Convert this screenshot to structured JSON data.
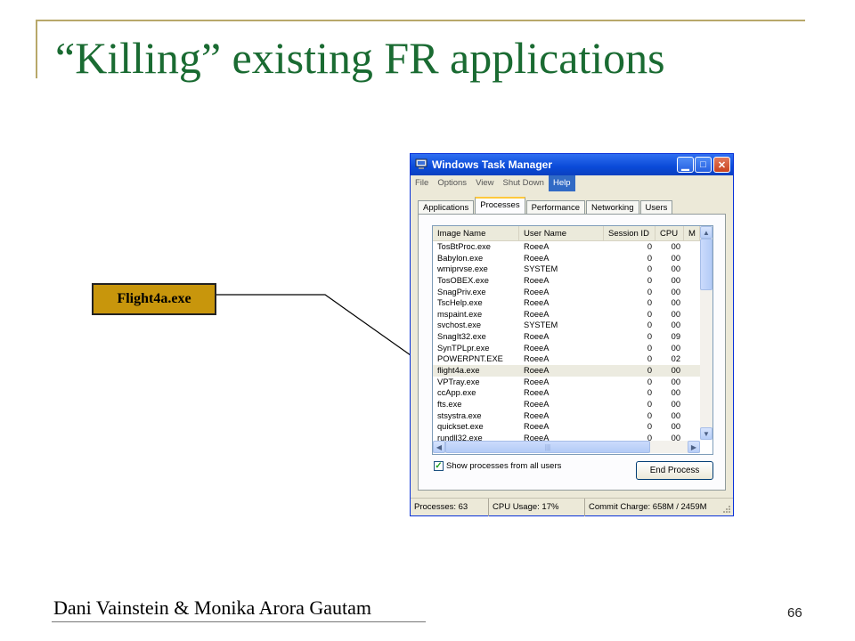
{
  "slide": {
    "title": "“Killing” existing FR applications",
    "callout_label": "Flight4a.exe",
    "footer_author": "Dani Vainstein & Monika Arora Gautam",
    "page_number": "66"
  },
  "window": {
    "title": "Windows Task Manager",
    "icon": "task-manager-icon",
    "controls": [
      "minimize-icon",
      "maximize-icon",
      "close-icon"
    ]
  },
  "menu": [
    "File",
    "Options",
    "View",
    "Shut Down",
    "Help"
  ],
  "tabs": [
    "Applications",
    "Processes",
    "Performance",
    "Networking",
    "Users"
  ],
  "active_tab": "Processes",
  "columns": [
    "Image Name",
    "User Name",
    "Session ID",
    "CPU",
    "M"
  ],
  "rows": [
    {
      "name": "TosBtProc.exe",
      "user": "RoeeA",
      "session": "0",
      "cpu": "00"
    },
    {
      "name": "Babylon.exe",
      "user": "RoeeA",
      "session": "0",
      "cpu": "00"
    },
    {
      "name": "wmiprvse.exe",
      "user": "SYSTEM",
      "session": "0",
      "cpu": "00"
    },
    {
      "name": "TosOBEX.exe",
      "user": "RoeeA",
      "session": "0",
      "cpu": "00"
    },
    {
      "name": "SnagPriv.exe",
      "user": "RoeeA",
      "session": "0",
      "cpu": "00"
    },
    {
      "name": "TscHelp.exe",
      "user": "RoeeA",
      "session": "0",
      "cpu": "00"
    },
    {
      "name": "mspaint.exe",
      "user": "RoeeA",
      "session": "0",
      "cpu": "00"
    },
    {
      "name": "svchost.exe",
      "user": "SYSTEM",
      "session": "0",
      "cpu": "00"
    },
    {
      "name": "SnagIt32.exe",
      "user": "RoeeA",
      "session": "0",
      "cpu": "09"
    },
    {
      "name": "SynTPLpr.exe",
      "user": "RoeeA",
      "session": "0",
      "cpu": "00"
    },
    {
      "name": "POWERPNT.EXE",
      "user": "RoeeA",
      "session": "0",
      "cpu": "02"
    },
    {
      "name": "flight4a.exe",
      "user": "RoeeA",
      "session": "0",
      "cpu": "00"
    },
    {
      "name": "VPTray.exe",
      "user": "RoeeA",
      "session": "0",
      "cpu": "00"
    },
    {
      "name": "ccApp.exe",
      "user": "RoeeA",
      "session": "0",
      "cpu": "00"
    },
    {
      "name": "fts.exe",
      "user": "RoeeA",
      "session": "0",
      "cpu": "00"
    },
    {
      "name": "stsystra.exe",
      "user": "RoeeA",
      "session": "0",
      "cpu": "00"
    },
    {
      "name": "quickset.exe",
      "user": "RoeeA",
      "session": "0",
      "cpu": "00"
    },
    {
      "name": "rundll32.exe",
      "user": "RoeeA",
      "session": "0",
      "cpu": "00"
    }
  ],
  "selected_row": "flight4a.exe",
  "show_all_label": "Show processes from all users",
  "show_all_checked": true,
  "end_process_label": "End Process",
  "status": {
    "processes": "Processes: 63",
    "cpu": "CPU Usage: 17%",
    "commit": "Commit Charge: 658M / 2459M"
  },
  "colors": {
    "title_green": "#1a6b32",
    "callout_gold": "#c8960c",
    "xp_blue": "#0a4ad8",
    "menu_highlight": "#316ac5"
  }
}
